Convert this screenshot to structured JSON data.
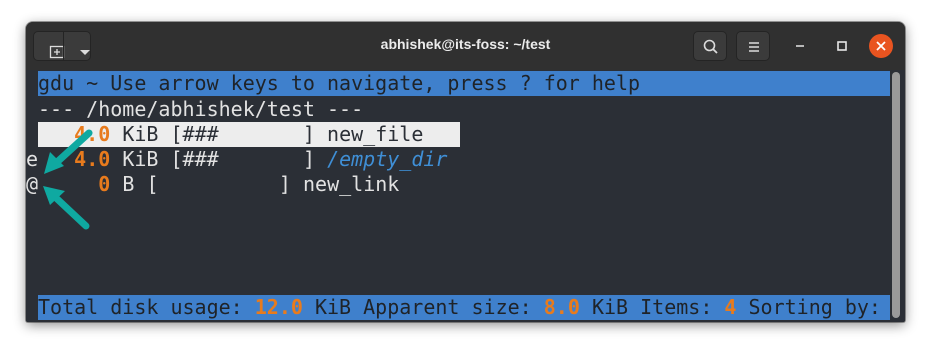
{
  "window": {
    "title": "abhishek@its-foss: ~/test"
  },
  "icons": {
    "new_tab": "new-tab-icon",
    "dropdown": "chevron-down-icon",
    "search": "search-icon",
    "menu": "hamburger-menu-icon",
    "minimize": "minimize-icon",
    "maximize": "maximize-icon",
    "close": "close-icon"
  },
  "colors": {
    "header_bar": "#3f80cc",
    "size_value": "#e87b1d",
    "directory": "#3f8fd6",
    "selected_row": "#ededed",
    "close_button": "#e95420",
    "annotation_arrow": "#0fa9a1"
  },
  "terminal": {
    "header": "gdu ~ Use arrow keys to navigate, press ? for help",
    "path_line": "--- /home/abhishek/test ---",
    "rows": [
      {
        "flag": " ",
        "size": "4.0",
        "unit": "KiB",
        "bar": "[###       ]",
        "name": "new_file",
        "selected": true
      },
      {
        "flag": "e",
        "size": "4.0",
        "unit": "KiB",
        "bar": "[###       ]",
        "name": "/empty_dir",
        "is_dir": true
      },
      {
        "flag": "@",
        "size": "0",
        "unit": "B",
        "bar": "[          ]",
        "name": "new_link"
      }
    ],
    "footer": {
      "total_label": "Total disk usage:",
      "total_value": "12.0",
      "total_unit": "KiB",
      "apparent_label": "Apparent size:",
      "apparent_value": "8.0",
      "apparent_unit": "KiB",
      "items_label": "Items:",
      "items_value": "4",
      "sorting_label": "Sorting by:"
    }
  }
}
